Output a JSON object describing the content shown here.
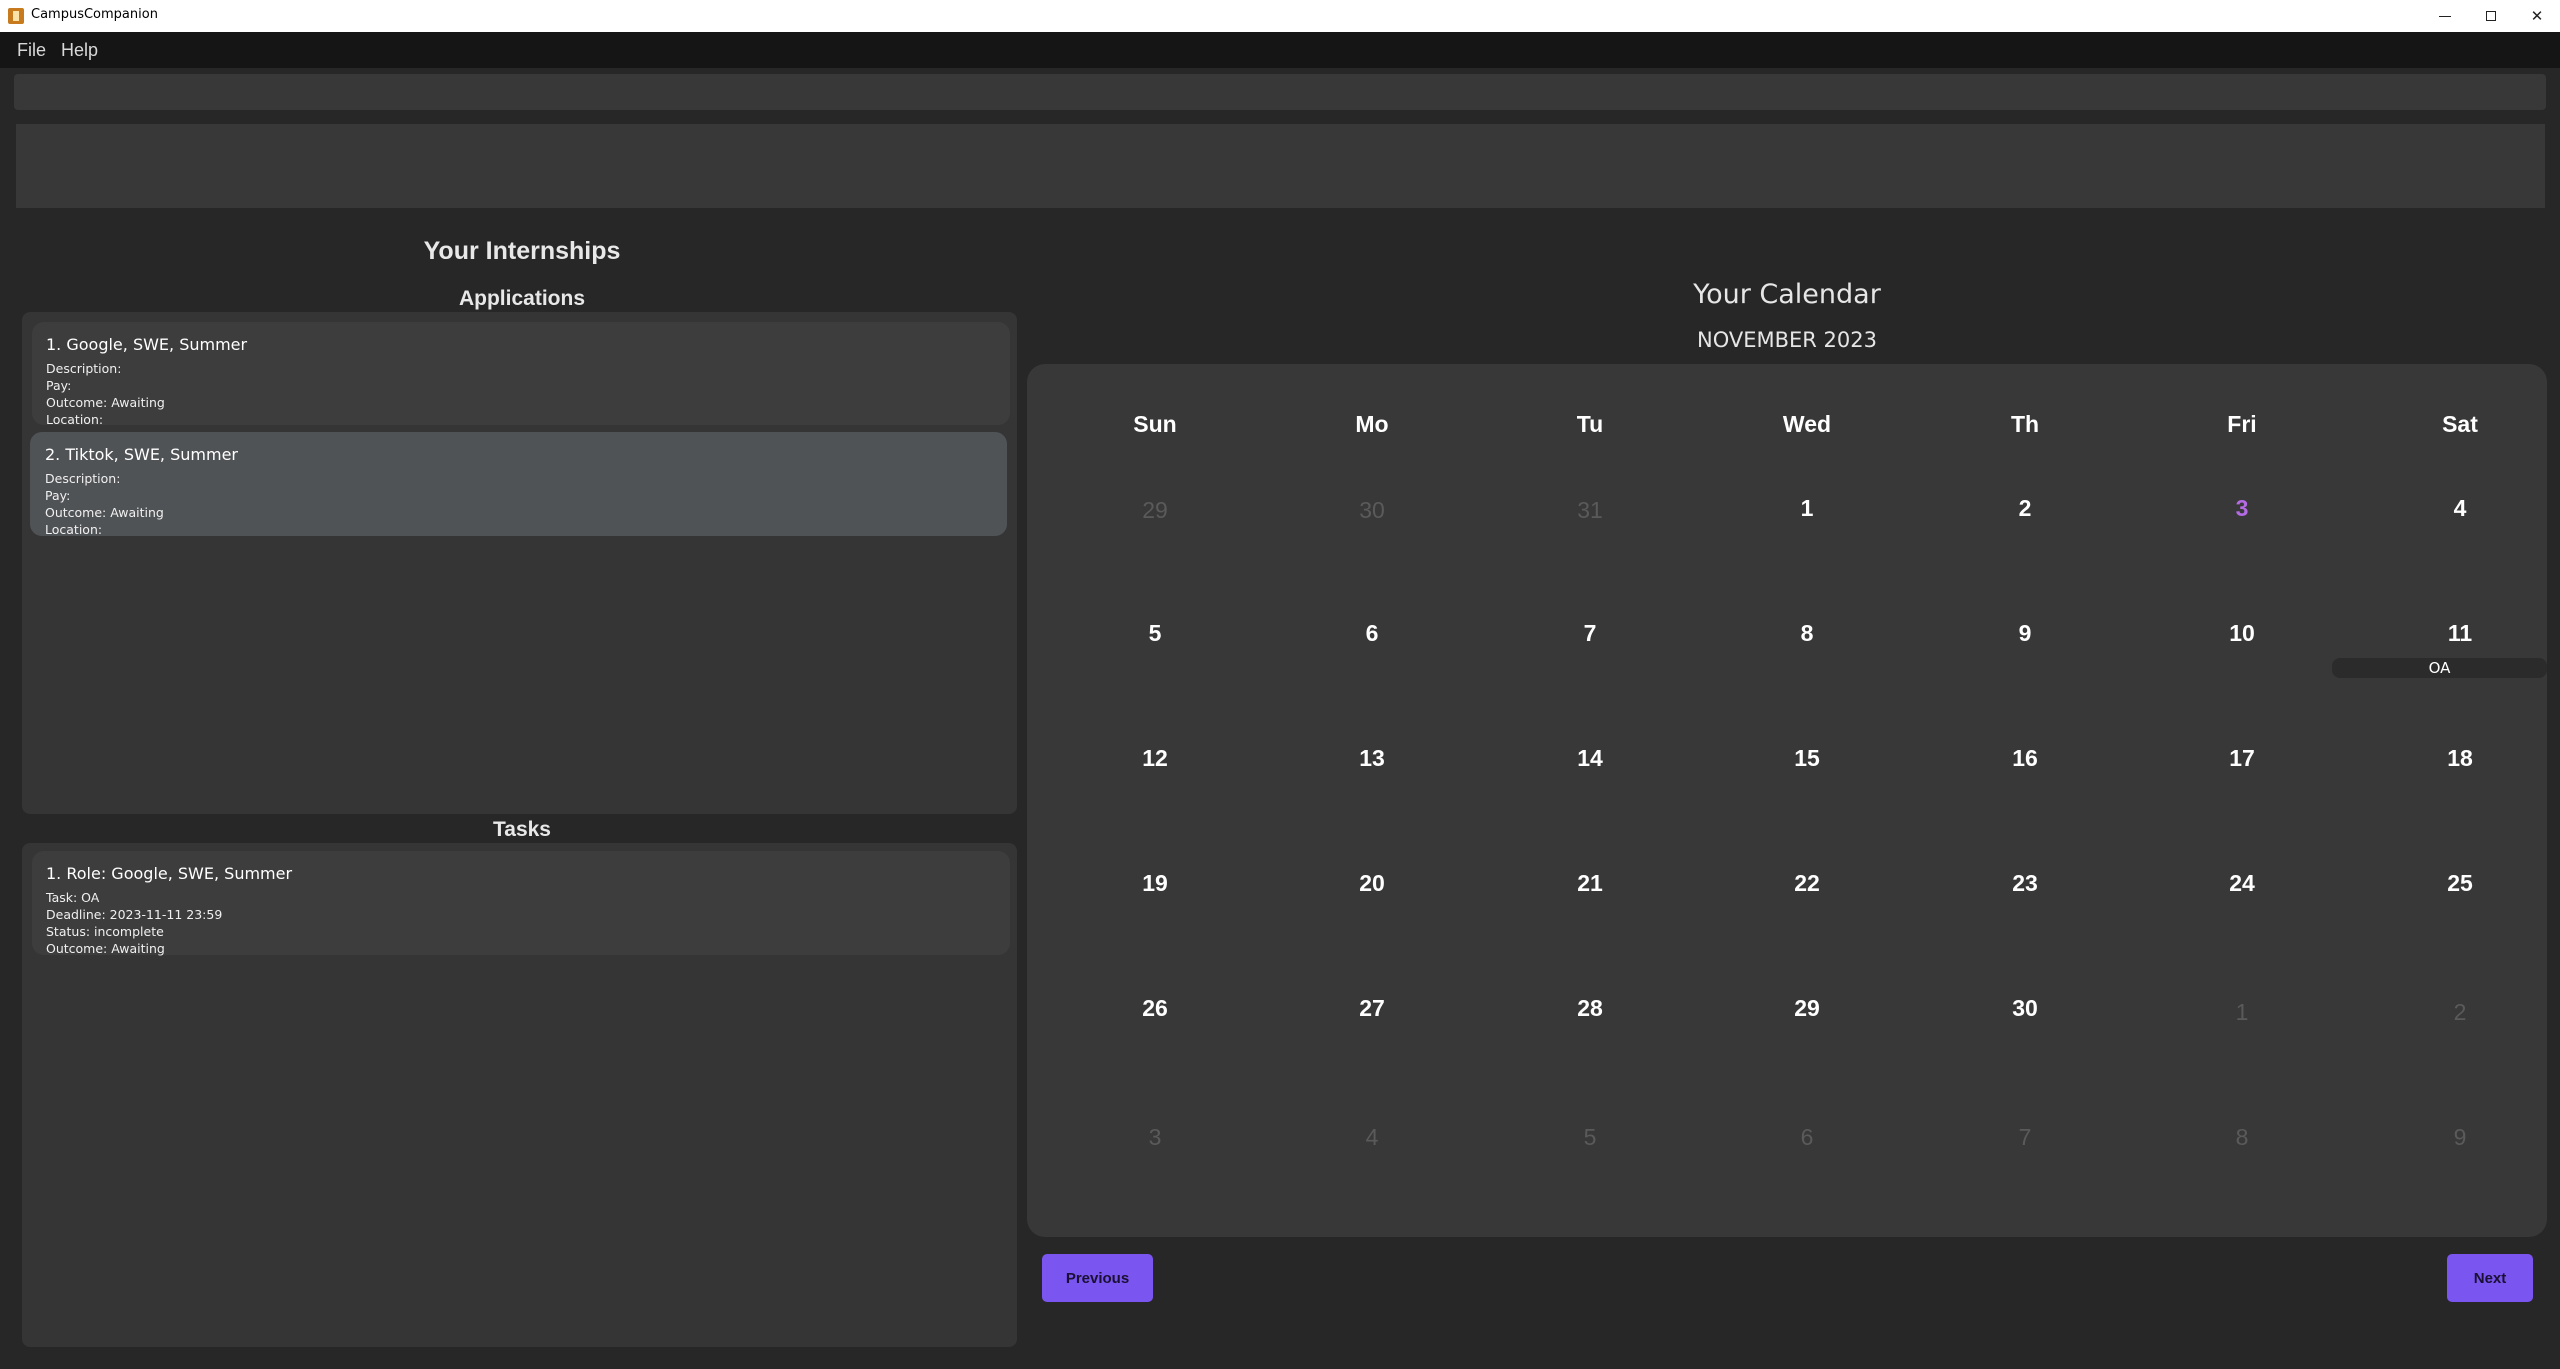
{
  "window": {
    "title": "CampusCompanion"
  },
  "menu": {
    "file": "File",
    "help": "Help"
  },
  "command_box": {
    "value": ""
  },
  "result_display": {
    "text": ""
  },
  "internships": {
    "title": "Your Internships",
    "applications_title": "Applications",
    "applications": [
      {
        "header": "1.  Google, SWE, Summer",
        "description": "Description:",
        "pay": "Pay:",
        "outcome": "Outcome: Awaiting",
        "location": "Location:"
      },
      {
        "header": "2.  Tiktok, SWE, Summer",
        "description": "Description:",
        "pay": "Pay:",
        "outcome": "Outcome: Awaiting",
        "location": "Location:"
      }
    ],
    "tasks_title": "Tasks",
    "tasks": [
      {
        "header": "1.  Role: Google, SWE, Summer",
        "task": "Task: OA",
        "deadline": "Deadline: 2023-11-11 23:59",
        "status": "Status: incomplete",
        "outcome": "Outcome: Awaiting"
      }
    ]
  },
  "calendar": {
    "title": "Your Calendar",
    "month": "NOVEMBER 2023",
    "days_of_week": [
      "Sun",
      "Mo",
      "Tu",
      "Wed",
      "Th",
      "Fri",
      "Sat"
    ],
    "weeks": [
      [
        "29",
        "30",
        "31",
        "1",
        "2",
        "3",
        "4"
      ],
      [
        "5",
        "6",
        "7",
        "8",
        "9",
        "10",
        "11"
      ],
      [
        "12",
        "13",
        "14",
        "15",
        "16",
        "17",
        "18"
      ],
      [
        "19",
        "20",
        "21",
        "22",
        "23",
        "24",
        "25"
      ],
      [
        "26",
        "27",
        "28",
        "29",
        "30",
        "1",
        "2"
      ],
      [
        "3",
        "4",
        "5",
        "6",
        "7",
        "8",
        "9"
      ]
    ],
    "today": "3",
    "event_11": "OA",
    "prev_label": "Previous",
    "next_label": "Next"
  },
  "colors": {
    "accent": "#7a55f0",
    "today": "#b36ae3",
    "background": "#272727"
  }
}
